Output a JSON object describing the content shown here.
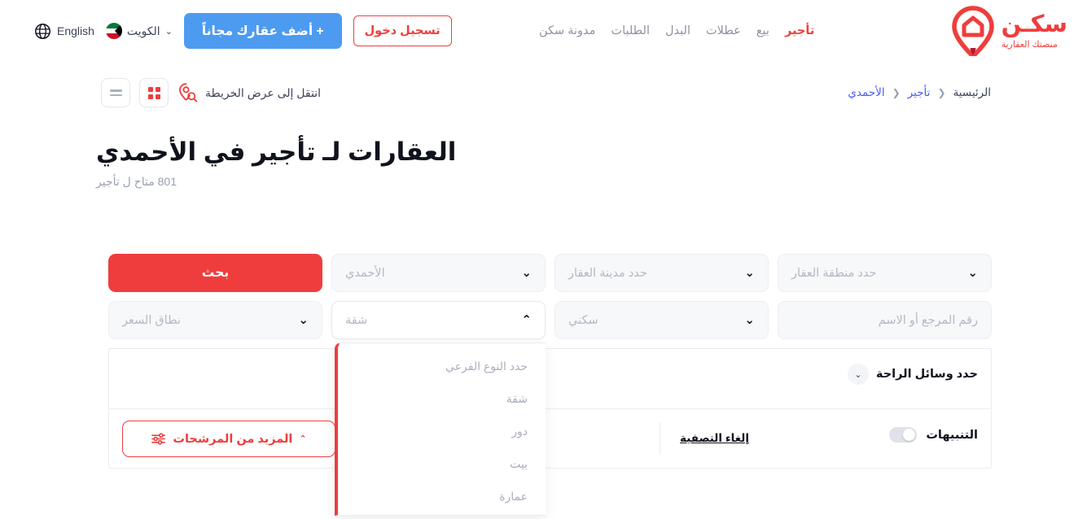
{
  "header": {
    "brand_name": "سكـن",
    "brand_tagline": "منصتك العقارية",
    "logo_icon": "location-pin-house-icon",
    "nav": [
      {
        "label": "تأجير",
        "active": true
      },
      {
        "label": "بيع",
        "active": false
      },
      {
        "label": "عطلات",
        "active": false
      },
      {
        "label": "البدل",
        "active": false
      },
      {
        "label": "الطلبات",
        "active": false
      },
      {
        "label": "مدونة سكن",
        "active": false
      }
    ],
    "language": {
      "label": "English",
      "icon": "globe-icon"
    },
    "country": {
      "label": "الكويت",
      "icon": "kuwait-flag-icon",
      "chevron": "⌄"
    },
    "add_property_label": "+ أضف عقارك مجاناً",
    "login_label": "تسجيل دخول"
  },
  "subbar": {
    "breadcrumb": [
      {
        "label": "الرئيسية"
      },
      {
        "label": "تأجير"
      },
      {
        "label": "الأحمدي"
      }
    ],
    "breadcrumb_separator": "❮",
    "map_link_label": "انتقل إلى عرض الخريطة",
    "map_link_icon": "map-search-pin-icon",
    "view_list_icon": "list-view-icon",
    "view_grid_icon": "grid-view-icon"
  },
  "page": {
    "title": "العقارات لـ تأجير في الأحمدي",
    "subtitle": "801 متاح ل تأجير"
  },
  "filters": {
    "search_button": "بحث",
    "row1": [
      {
        "placeholder": "حدد منطقة العقار",
        "chevron": "⌄",
        "type": "select"
      },
      {
        "placeholder": "حدد مدينة العقار",
        "chevron": "⌄",
        "type": "select"
      },
      {
        "placeholder": "الأحمدي",
        "chevron": "⌄",
        "type": "select"
      }
    ],
    "row2": [
      {
        "placeholder": "نطاق السعر",
        "chevron": "⌄",
        "type": "select"
      },
      {
        "placeholder": "شقة",
        "chevron": "⌃",
        "type": "select-open"
      },
      {
        "placeholder": "سكني",
        "chevron": "⌄",
        "type": "select"
      },
      {
        "placeholder": "رقم المرجع أو الاسم",
        "chevron": "",
        "type": "text"
      }
    ],
    "subtype_dropdown": {
      "options": [
        "حدد النوع الفرعي",
        "شقة",
        "دور",
        "بيت",
        "عمارة"
      ]
    },
    "amenities_label": "حدد وسائل الراحة",
    "amenities_chevron": "⌄",
    "alerts_label": "التنبيهات",
    "alerts_enabled": false,
    "clear_filters_label": "إلغاء التصفية",
    "more_filters_label": "المزيد من المرشحات",
    "more_filters_chevron": "⌃",
    "more_filters_icon": "sliders-filter-icon"
  },
  "colors": {
    "brand_red": "#ef3d3d",
    "accent_blue": "#4d9bf0",
    "link_blue": "#4a5af0",
    "text_dark": "#10131c",
    "text_muted": "#9aa0b0"
  }
}
